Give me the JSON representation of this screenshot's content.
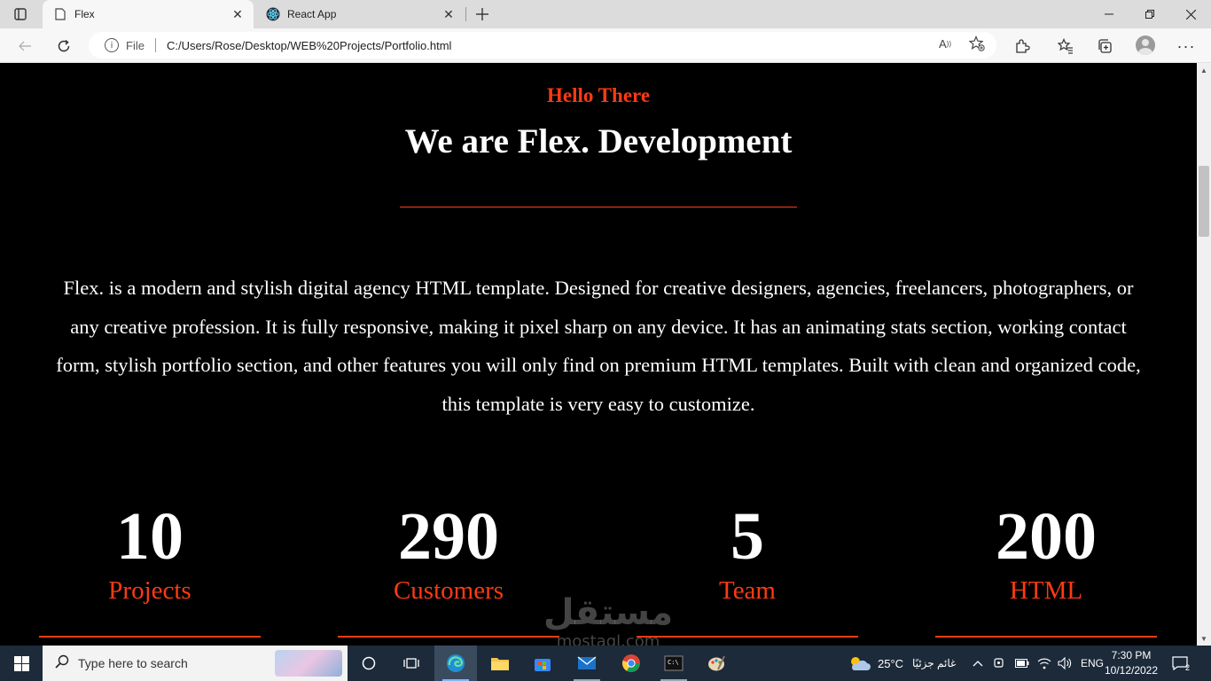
{
  "browser": {
    "tabs": [
      {
        "title": "Flex",
        "active": true
      },
      {
        "title": "React App",
        "active": false
      }
    ],
    "address": {
      "scheme": "File",
      "url": "C:/Users/Rose/Desktop/WEB%20Projects/Portfolio.html"
    }
  },
  "page": {
    "greeting": "Hello There",
    "headline": "We are Flex. Development",
    "about": "Flex. is a modern and stylish digital agency HTML template. Designed for creative designers, agencies, freelancers, photographers, or any creative profession. It is fully responsive, making it pixel sharp on any device. It has an animating stats section, working contact form, stylish portfolio section, and other features you will only find on premium HTML templates. Built with clean and organized code, this template is very easy to customize.",
    "stats": [
      {
        "value": "10",
        "label": "Projects"
      },
      {
        "value": "290",
        "label": "Customers"
      },
      {
        "value": "5",
        "label": "Team"
      },
      {
        "value": "200",
        "label": "HTML"
      }
    ],
    "accent_color": "#ff3a12"
  },
  "watermark": {
    "line1": "مستقل",
    "line2": "mostaql.com"
  },
  "taskbar": {
    "search_placeholder": "Type here to search",
    "weather_temp": "25°C",
    "weather_desc": "غائم جزئيًا",
    "language": "ENG",
    "time": "7:30 PM",
    "date": "10/12/2022",
    "notification_count": "2"
  }
}
